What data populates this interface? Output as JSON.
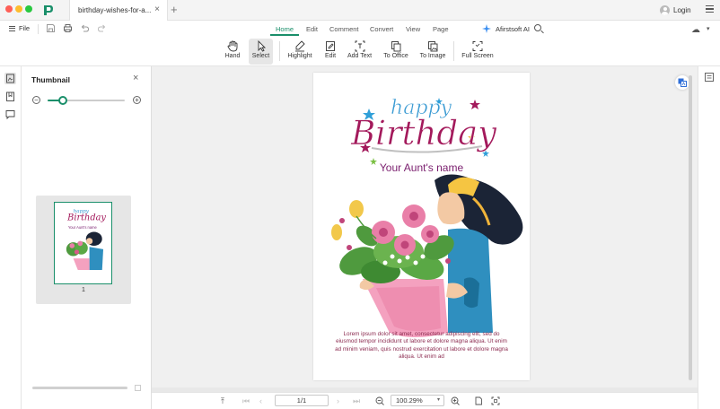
{
  "window": {
    "tab_title": "birthday-wishes-for-a...",
    "login_label": "Login"
  },
  "menubar": {
    "file_label": "File",
    "tabs": [
      "Home",
      "Edit",
      "Comment",
      "Convert",
      "View",
      "Page"
    ],
    "active_tab": "Home",
    "ai_label": "Afirstsoft AI"
  },
  "toolbar": {
    "tools": [
      {
        "label": "Hand",
        "icon": "hand-icon"
      },
      {
        "label": "Select",
        "icon": "cursor-icon",
        "active": true
      },
      {
        "label": "Highlight",
        "icon": "highlighter-icon"
      },
      {
        "label": "Edit",
        "icon": "edit-icon"
      },
      {
        "label": "Add Text",
        "icon": "add-text-icon"
      },
      {
        "label": "To Office",
        "icon": "to-office-icon"
      },
      {
        "label": "To Image",
        "icon": "to-image-icon"
      },
      {
        "label": "Full Screen",
        "icon": "full-screen-icon"
      }
    ]
  },
  "thumbnail_panel": {
    "title": "Thumbnail",
    "zoom_level": 0.2,
    "page_number": "1"
  },
  "document": {
    "happy": "happy",
    "birthday": "Birthday",
    "name": "Your Aunt's name",
    "body": "Lorem ipsum dolor sit amet, consectetur adipiscing elit, sed do eiusmod tempor incididunt ut labore et dolore magna aliqua. Ut enim ad minim veniam, quis nostrud exercitation ut labore et dolore magna aliqua. Ut enim ad"
  },
  "statusbar": {
    "page_display": "1/1",
    "zoom": "100.29%"
  },
  "colors": {
    "accent": "#1a8f6a",
    "title_purple": "#7a1e6e",
    "body_text": "#8b2a4f"
  }
}
